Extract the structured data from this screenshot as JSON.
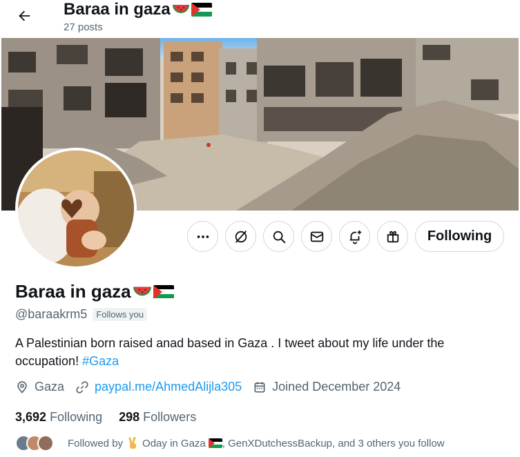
{
  "header": {
    "name": "Baraa in gaza",
    "posts_count": "27 posts"
  },
  "profile": {
    "display_name": "Baraa in gaza",
    "handle": "@baraakrm5",
    "follows_you": "Follows you",
    "bio_text": "A Palestinian born raised anad based in Gaza . I tweet about my life under the occupation! ",
    "bio_hashtag": "#Gaza",
    "location": "Gaza",
    "website": "paypal.me/AhmedAlijla305",
    "joined": "Joined December 2024",
    "following_count": "3,692",
    "following_label": "Following",
    "followers_count": "298",
    "followers_label": "Followers"
  },
  "actions": {
    "following_label": "Following"
  },
  "followed_by": {
    "prefix": "Followed by",
    "user1": "Oday in Gaza",
    "rest": ", GenXDutchessBackup, and 3 others you follow"
  },
  "colors": {
    "accent": "#1d9bf0",
    "text": "#0f1419",
    "muted": "#536471",
    "border": "#cfd9de"
  },
  "icons": {
    "back": "arrow-left-icon",
    "more": "more-dots-icon",
    "grok": "grok-icon",
    "search": "search-icon",
    "message": "mail-icon",
    "notify": "bell-plus-icon",
    "subscribe": "gift-icon",
    "location": "location-pin-icon",
    "link": "link-icon",
    "calendar": "calendar-icon"
  }
}
